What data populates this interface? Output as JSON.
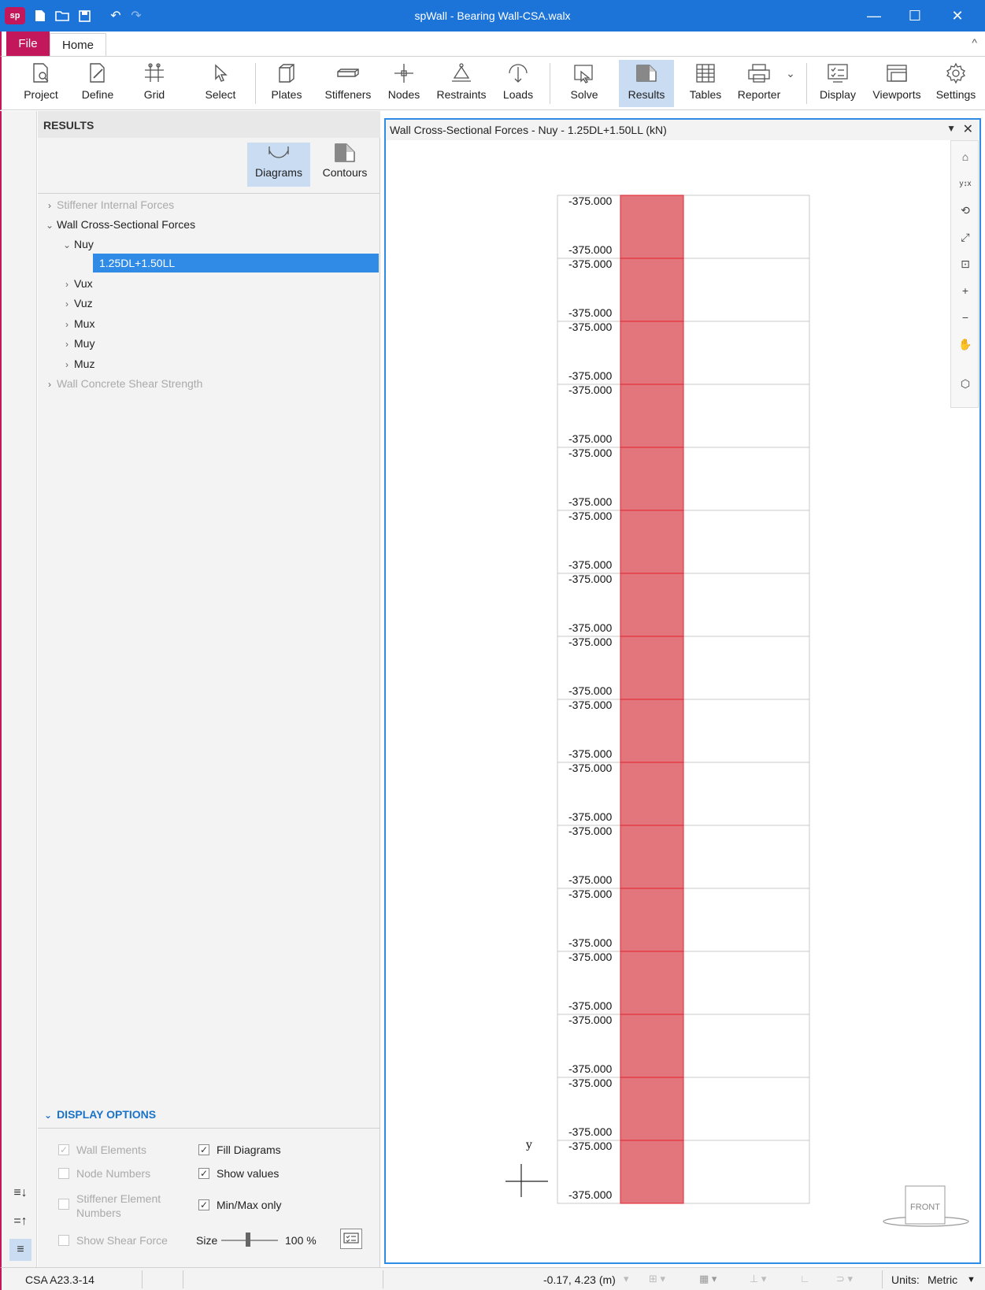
{
  "window": {
    "title": "spWall - Bearing Wall-CSA.walx"
  },
  "tabs": {
    "file": "File",
    "home": "Home"
  },
  "ribbon": [
    {
      "id": "project",
      "label": "Project"
    },
    {
      "id": "define",
      "label": "Define"
    },
    {
      "id": "grid",
      "label": "Grid"
    },
    {
      "id": "select",
      "label": "Select"
    },
    {
      "id": "plates",
      "label": "Plates"
    },
    {
      "id": "stiffeners",
      "label": "Stiffeners"
    },
    {
      "id": "nodes",
      "label": "Nodes"
    },
    {
      "id": "restraints",
      "label": "Restraints"
    },
    {
      "id": "loads",
      "label": "Loads"
    },
    {
      "id": "solve",
      "label": "Solve"
    },
    {
      "id": "results",
      "label": "Results"
    },
    {
      "id": "tables",
      "label": "Tables"
    },
    {
      "id": "reporter",
      "label": "Reporter"
    },
    {
      "id": "display",
      "label": "Display"
    },
    {
      "id": "viewports",
      "label": "Viewports"
    },
    {
      "id": "settings",
      "label": "Settings"
    }
  ],
  "panel": {
    "title": "RESULTS",
    "modes": {
      "diagrams": "Diagrams",
      "contours": "Contours"
    },
    "tree": [
      {
        "label": "Stiffener Internal Forces",
        "level": 0,
        "state": "collapsed",
        "disabled": true
      },
      {
        "label": "Wall Cross-Sectional Forces",
        "level": 0,
        "state": "expanded",
        "disabled": false
      },
      {
        "label": "Nuy",
        "level": 1,
        "state": "expanded",
        "disabled": false
      },
      {
        "label": "1.25DL+1.50LL",
        "level": 2,
        "state": "leaf",
        "selected": true
      },
      {
        "label": "Vux",
        "level": 1,
        "state": "collapsed",
        "disabled": false
      },
      {
        "label": "Vuz",
        "level": 1,
        "state": "collapsed",
        "disabled": false
      },
      {
        "label": "Mux",
        "level": 1,
        "state": "collapsed",
        "disabled": false
      },
      {
        "label": "Muy",
        "level": 1,
        "state": "collapsed",
        "disabled": false
      },
      {
        "label": "Muz",
        "level": 1,
        "state": "collapsed",
        "disabled": false
      },
      {
        "label": "Wall Concrete Shear Strength",
        "level": 0,
        "state": "collapsed",
        "disabled": true
      }
    ],
    "display_options": {
      "title": "DISPLAY OPTIONS",
      "wall_elements": {
        "label": "Wall Elements",
        "checked": true
      },
      "node_numbers": {
        "label": "Node Numbers",
        "checked": false
      },
      "stiffener_numbers": {
        "label": "Stiffener Element Numbers",
        "checked": false
      },
      "show_shear": {
        "label": "Show Shear Force",
        "checked": false
      },
      "fill_diagrams": {
        "label": "Fill Diagrams",
        "checked": true
      },
      "show_values": {
        "label": "Show values",
        "checked": true
      },
      "minmax_only": {
        "label": "Min/Max only",
        "checked": true
      },
      "size_label": "Size",
      "size_value": "100 %"
    }
  },
  "viewport": {
    "title": "Wall Cross-Sectional Forces - Nuy - 1.25DL+1.50LL (kN)",
    "axis_label": "y",
    "front_label": "FRONT",
    "value_label": "-375.000",
    "segment_count": 16,
    "fill_color": "#e3767d",
    "line_color": "#e0232a"
  },
  "status": {
    "code": "CSA A23.3-14",
    "coords": "-0.17, 4.23 (m)",
    "units_label": "Units:",
    "units_value": "Metric"
  },
  "colors": {
    "accent": "#1d74d8",
    "file_tab": "#c2185b",
    "selection": "#2f8be6",
    "section_header": "#1a73c9"
  }
}
